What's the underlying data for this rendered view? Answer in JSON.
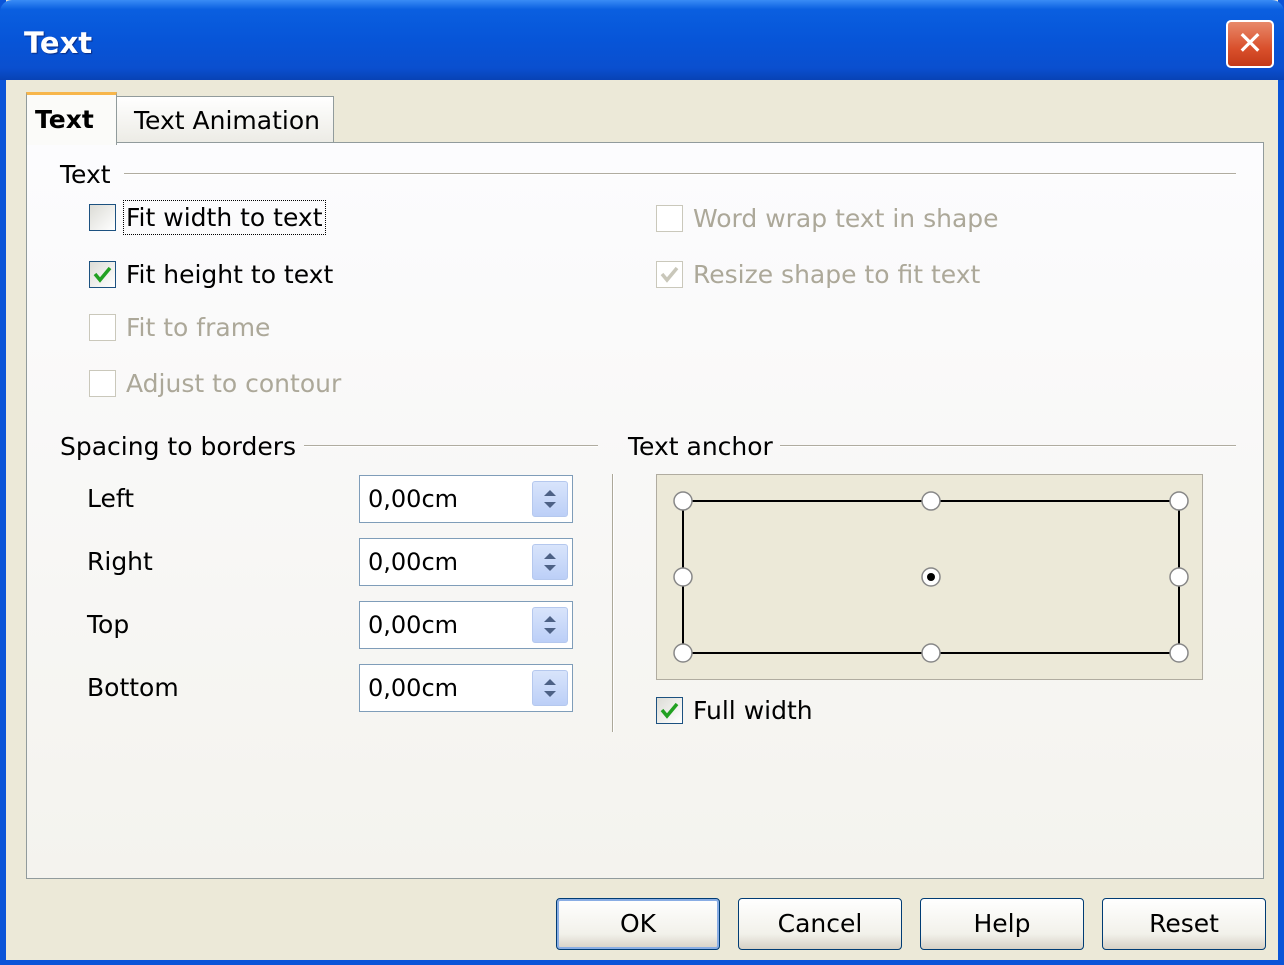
{
  "window": {
    "title": "Text",
    "close_icon": "close-icon"
  },
  "tabs": [
    {
      "label": "Text",
      "active": true
    },
    {
      "label": "Text Animation",
      "active": false
    }
  ],
  "text_group": {
    "title": "Text",
    "options": [
      {
        "label": "Fit width to text",
        "checked": false,
        "enabled": true,
        "focused": true
      },
      {
        "label": "Fit height to text",
        "checked": true,
        "enabled": true
      },
      {
        "label": "Fit to frame",
        "checked": false,
        "enabled": false
      },
      {
        "label": "Adjust to contour",
        "checked": false,
        "enabled": false
      },
      {
        "label": "Word wrap text in shape",
        "checked": false,
        "enabled": false
      },
      {
        "label": "Resize shape to fit text",
        "checked": true,
        "enabled": false
      }
    ]
  },
  "spacing_group": {
    "title": "Spacing to borders",
    "fields": [
      {
        "label": "Left",
        "value": "0,00cm"
      },
      {
        "label": "Right",
        "value": "0,00cm"
      },
      {
        "label": "Top",
        "value": "0,00cm"
      },
      {
        "label": "Bottom",
        "value": "0,00cm"
      }
    ]
  },
  "anchor_group": {
    "title": "Text anchor",
    "selected": "center",
    "full_width": {
      "label": "Full width",
      "checked": true
    }
  },
  "buttons": {
    "ok": "OK",
    "cancel": "Cancel",
    "help": "Help",
    "reset": "Reset"
  },
  "colors": {
    "title_bar": "#0755d8",
    "dialog_bg": "#ece9d8",
    "check_green": "#21a121",
    "tab_highlight": "#f7b64b"
  }
}
